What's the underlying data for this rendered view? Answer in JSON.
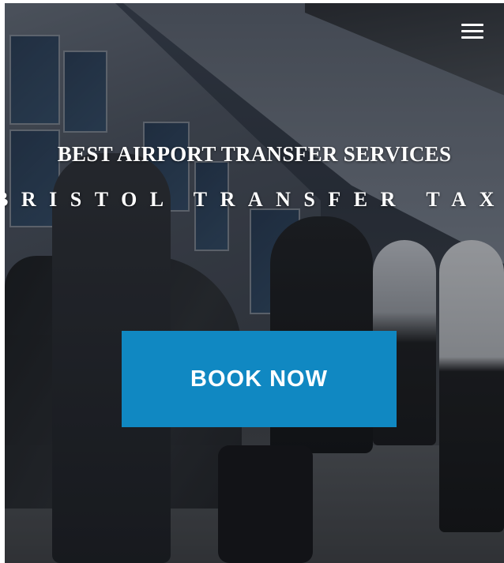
{
  "hero": {
    "headline": "BEST AIRPORT TRANSFER SERVICES",
    "subline": "BRISTOL TRANSFER TAXI",
    "cta_label": "BOOK NOW"
  },
  "colors": {
    "cta_background": "#1088c2",
    "text": "#ffffff"
  },
  "icons": {
    "menu": "hamburger-menu-icon"
  }
}
